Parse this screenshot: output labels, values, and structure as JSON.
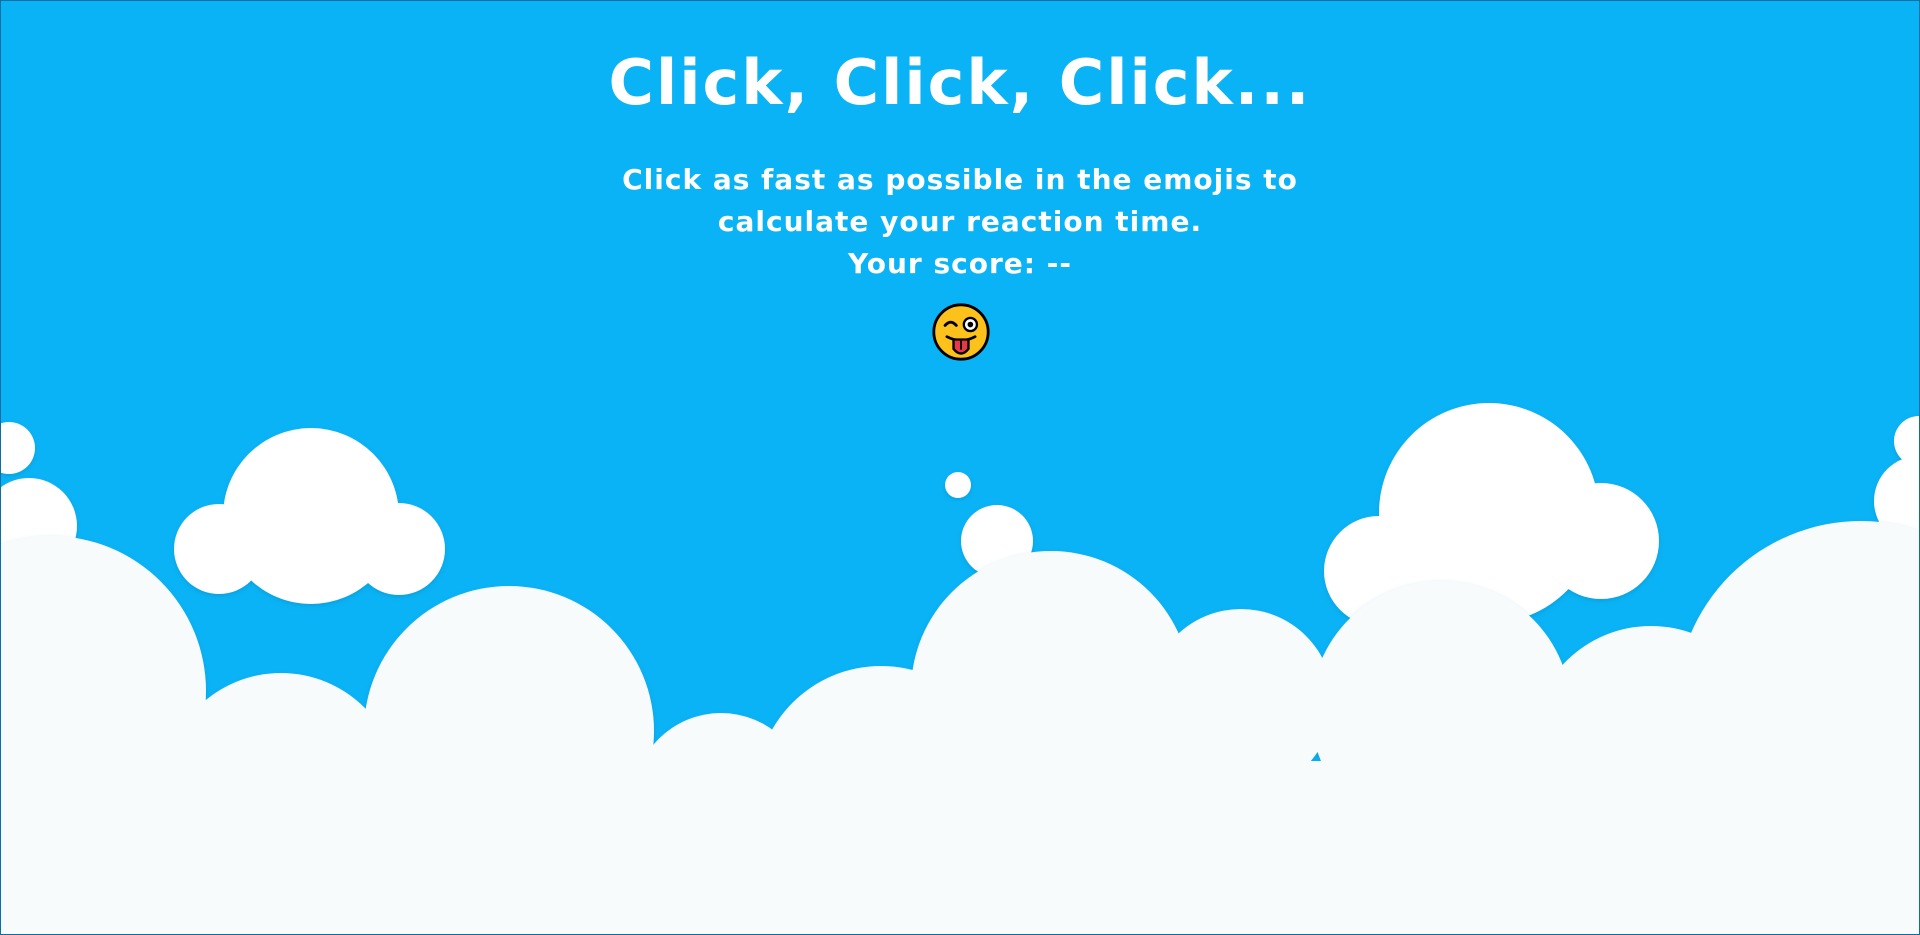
{
  "game": {
    "title": "Click, Click, Click...",
    "instructions": "Click as fast as possible in the emojis to calculate your reaction time.",
    "score_label": "Your score:",
    "score_value": "--",
    "target_emoji": "winking-face-with-tongue"
  },
  "colors": {
    "sky": "#0ab3f5",
    "cloud": "#ffffff",
    "cloud_shade": "#f3f8fa",
    "text": "#ffffff",
    "emoji_face": "#fcc21b",
    "emoji_tongue": "#e5384b"
  }
}
